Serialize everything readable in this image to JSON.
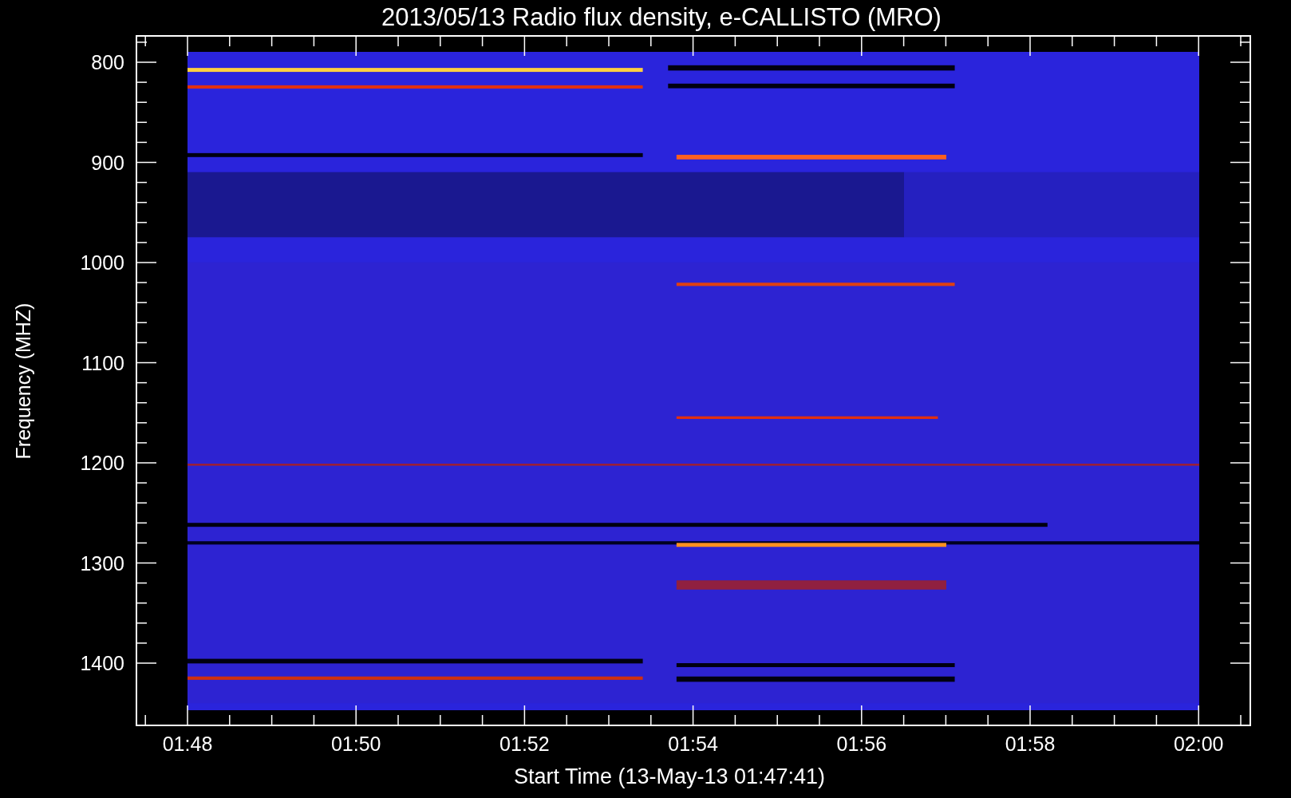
{
  "title": "2013/05/13  Radio flux density, e-CALLISTO (MRO)",
  "ylabel": "Frequency (MHZ)",
  "xlabel": "Start Time (13-May-13 01:47:41)",
  "yticks": [
    "800",
    "900",
    "1000",
    "1100",
    "1200",
    "1300",
    "1400"
  ],
  "xticks": [
    "01:48",
    "01:50",
    "01:52",
    "01:54",
    "01:56",
    "01:58",
    "02:00"
  ]
}
